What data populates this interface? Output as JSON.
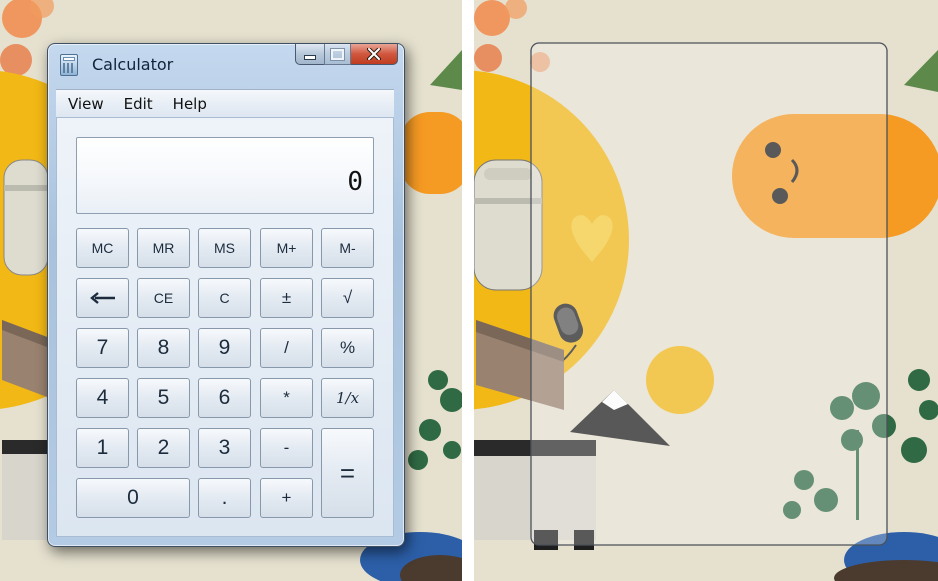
{
  "calculator": {
    "title": "Calculator",
    "menu": [
      "View",
      "Edit",
      "Help"
    ],
    "display": "0",
    "keys": {
      "mc": "MC",
      "mr": "MR",
      "ms": "MS",
      "mplus": "M+",
      "mminus": "M-",
      "ce": "CE",
      "c": "C",
      "plusminus": "±",
      "sqrt": "√",
      "seven": "7",
      "eight": "8",
      "nine": "9",
      "divide": "/",
      "percent": "%",
      "four": "4",
      "five": "5",
      "six": "6",
      "multiply": "*",
      "reciprocal": "1/x",
      "one": "1",
      "two": "2",
      "three": "3",
      "minus": "-",
      "equals": "=",
      "zero": "0",
      "decimal": ".",
      "plus": "+"
    },
    "icons": {
      "app": "calculator-icon",
      "backspace": "back-arrow-icon",
      "minimize": "minimize-icon",
      "maximize": "maximize-icon",
      "close": "close-icon"
    }
  },
  "colors": {
    "wallpaper": "#e6e1cf",
    "sun_yellow": "#f2b815",
    "orange": "#f59a23",
    "close_red": "#c84a2e",
    "window_frame": "#b3cbe4"
  }
}
